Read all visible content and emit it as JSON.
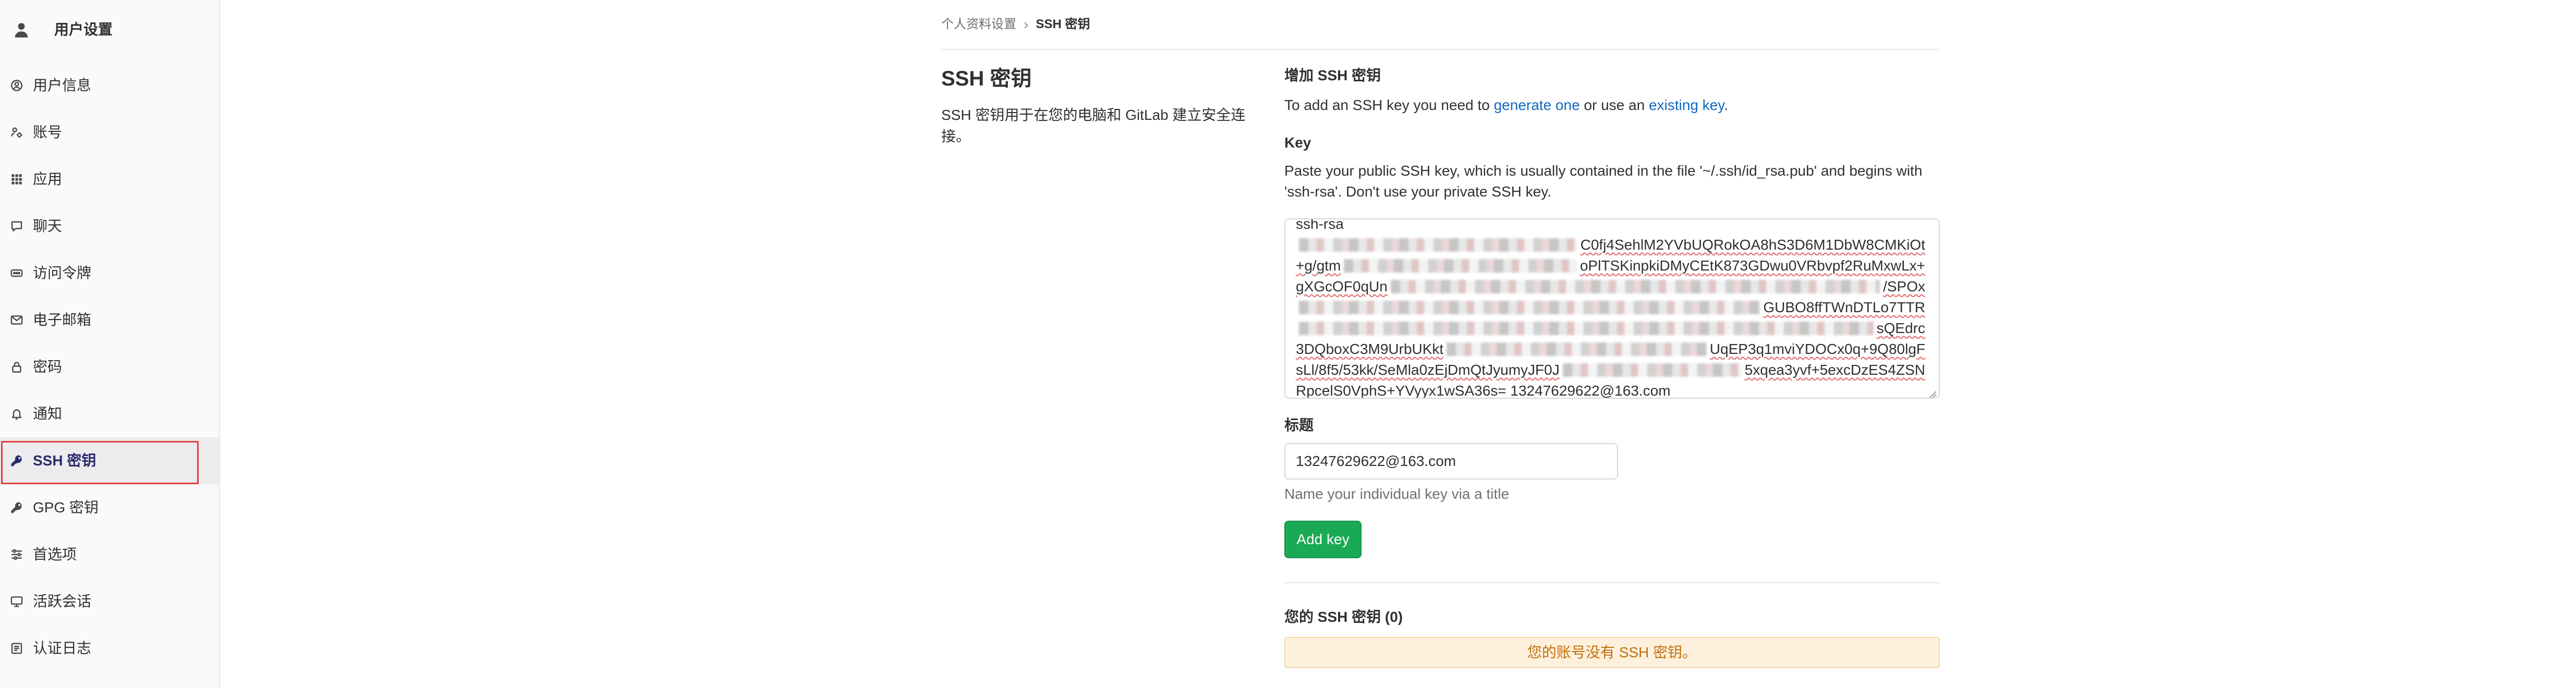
{
  "sidebar": {
    "title": "用户设置",
    "items": [
      {
        "label": "用户信息",
        "icon": "user-profile-icon"
      },
      {
        "label": "账号",
        "icon": "account-icon"
      },
      {
        "label": "应用",
        "icon": "applications-icon"
      },
      {
        "label": "聊天",
        "icon": "chat-icon"
      },
      {
        "label": "访问令牌",
        "icon": "token-icon"
      },
      {
        "label": "电子邮箱",
        "icon": "mail-icon"
      },
      {
        "label": "密码",
        "icon": "lock-icon"
      },
      {
        "label": "通知",
        "icon": "bell-icon"
      },
      {
        "label": "SSH 密钥",
        "icon": "key-icon",
        "active": true
      },
      {
        "label": "GPG 密钥",
        "icon": "key-icon"
      },
      {
        "label": "首选项",
        "icon": "preferences-icon"
      },
      {
        "label": "活跃会话",
        "icon": "monitor-icon"
      },
      {
        "label": "认证日志",
        "icon": "log-icon"
      }
    ]
  },
  "breadcrumb": {
    "parent": "个人资料设置",
    "separator": "›",
    "current": "SSH 密钥"
  },
  "intro": {
    "title": "SSH 密钥",
    "description": "SSH 密钥用于在您的电脑和 GitLab 建立安全连接。"
  },
  "add_key": {
    "heading": "增加 SSH 密钥",
    "instruction": {
      "before": "To add an SSH key you need to ",
      "link_generate": "generate one",
      "middle": " or use an ",
      "link_existing": "existing key",
      "after": "."
    },
    "key_label": "Key",
    "key_help": "Paste your public SSH key, which is usually contained in the file '~/.ssh/id_rsa.pub' and begins with 'ssh-rsa'. Don't use your private SSH key.",
    "key_lines": [
      [
        "ssh-rsa"
      ],
      [
        "C0fj4SehlM2YVbUQRokOA8hS3D6M1DbW8CMKiOt"
      ],
      [
        "+g/gtm",
        "oPlTSKinpkiDMyCEtK873GDwu0VRbvpf2RuMxwLx+"
      ],
      [
        "gXGcOF0qUn",
        "/SPOx"
      ],
      [
        "GUBO8ffTWnDTLo7TTR"
      ],
      [
        "sQEdrc"
      ],
      [
        "3DQboxC3M9UrbUKkt",
        "UqEP3q1mviYDOCx0q+9Q80lgF"
      ],
      [
        "sLl/8f5/53kk/SeMla0zEjDmQtJyumyJF0J",
        "5xqea3yvf+5excDzES4ZSN"
      ],
      [
        "RpcelS0VphS+YVyyx1wSA36s= 13247629622@163.com"
      ]
    ],
    "title_label": "标题",
    "title_value": "13247629622@163.com",
    "title_help": "Name your individual key via a title",
    "submit_label": "Add key"
  },
  "keys_list": {
    "heading": "您的 SSH 密钥 (0)",
    "empty_message": "您的账号没有 SSH 密钥。"
  },
  "colors": {
    "link": "#1068bf",
    "button_green": "#1aaa55",
    "alert_background": "#fdf1dd",
    "alert_text": "#c0700d",
    "active_nav_text": "#2b2b6b",
    "annotation_red": "#e2403a"
  }
}
